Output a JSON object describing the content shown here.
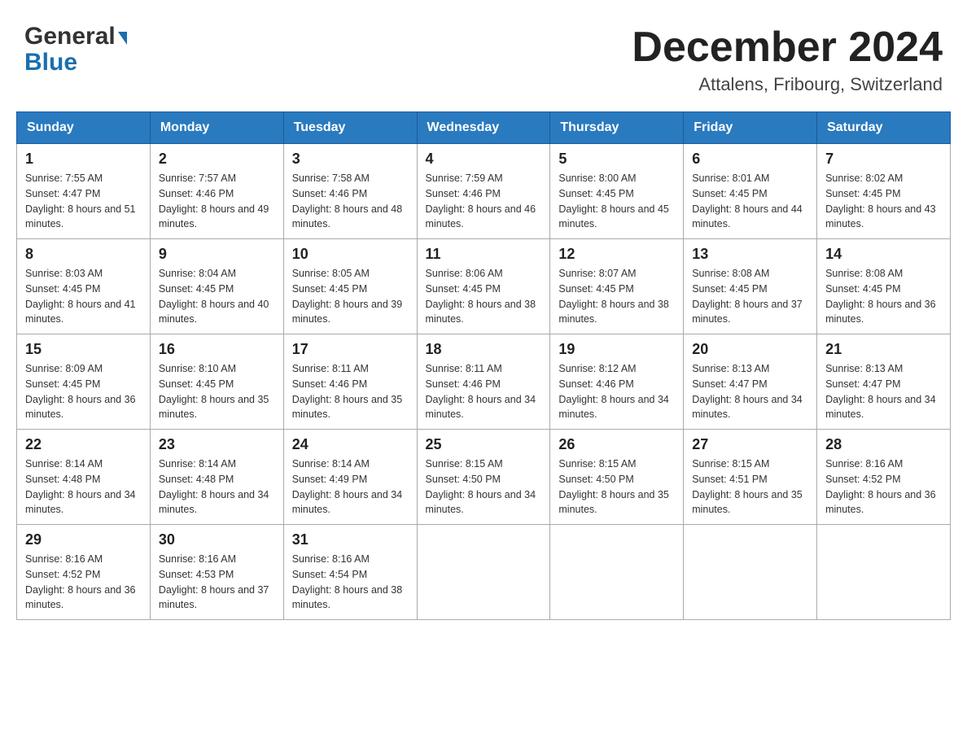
{
  "header": {
    "logo_general": "General",
    "logo_blue": "Blue",
    "main_title": "December 2024",
    "subtitle": "Attalens, Fribourg, Switzerland"
  },
  "weekdays": [
    "Sunday",
    "Monday",
    "Tuesday",
    "Wednesday",
    "Thursday",
    "Friday",
    "Saturday"
  ],
  "weeks": [
    [
      {
        "day": "1",
        "sunrise": "Sunrise: 7:55 AM",
        "sunset": "Sunset: 4:47 PM",
        "daylight": "Daylight: 8 hours and 51 minutes."
      },
      {
        "day": "2",
        "sunrise": "Sunrise: 7:57 AM",
        "sunset": "Sunset: 4:46 PM",
        "daylight": "Daylight: 8 hours and 49 minutes."
      },
      {
        "day": "3",
        "sunrise": "Sunrise: 7:58 AM",
        "sunset": "Sunset: 4:46 PM",
        "daylight": "Daylight: 8 hours and 48 minutes."
      },
      {
        "day": "4",
        "sunrise": "Sunrise: 7:59 AM",
        "sunset": "Sunset: 4:46 PM",
        "daylight": "Daylight: 8 hours and 46 minutes."
      },
      {
        "day": "5",
        "sunrise": "Sunrise: 8:00 AM",
        "sunset": "Sunset: 4:45 PM",
        "daylight": "Daylight: 8 hours and 45 minutes."
      },
      {
        "day": "6",
        "sunrise": "Sunrise: 8:01 AM",
        "sunset": "Sunset: 4:45 PM",
        "daylight": "Daylight: 8 hours and 44 minutes."
      },
      {
        "day": "7",
        "sunrise": "Sunrise: 8:02 AM",
        "sunset": "Sunset: 4:45 PM",
        "daylight": "Daylight: 8 hours and 43 minutes."
      }
    ],
    [
      {
        "day": "8",
        "sunrise": "Sunrise: 8:03 AM",
        "sunset": "Sunset: 4:45 PM",
        "daylight": "Daylight: 8 hours and 41 minutes."
      },
      {
        "day": "9",
        "sunrise": "Sunrise: 8:04 AM",
        "sunset": "Sunset: 4:45 PM",
        "daylight": "Daylight: 8 hours and 40 minutes."
      },
      {
        "day": "10",
        "sunrise": "Sunrise: 8:05 AM",
        "sunset": "Sunset: 4:45 PM",
        "daylight": "Daylight: 8 hours and 39 minutes."
      },
      {
        "day": "11",
        "sunrise": "Sunrise: 8:06 AM",
        "sunset": "Sunset: 4:45 PM",
        "daylight": "Daylight: 8 hours and 38 minutes."
      },
      {
        "day": "12",
        "sunrise": "Sunrise: 8:07 AM",
        "sunset": "Sunset: 4:45 PM",
        "daylight": "Daylight: 8 hours and 38 minutes."
      },
      {
        "day": "13",
        "sunrise": "Sunrise: 8:08 AM",
        "sunset": "Sunset: 4:45 PM",
        "daylight": "Daylight: 8 hours and 37 minutes."
      },
      {
        "day": "14",
        "sunrise": "Sunrise: 8:08 AM",
        "sunset": "Sunset: 4:45 PM",
        "daylight": "Daylight: 8 hours and 36 minutes."
      }
    ],
    [
      {
        "day": "15",
        "sunrise": "Sunrise: 8:09 AM",
        "sunset": "Sunset: 4:45 PM",
        "daylight": "Daylight: 8 hours and 36 minutes."
      },
      {
        "day": "16",
        "sunrise": "Sunrise: 8:10 AM",
        "sunset": "Sunset: 4:45 PM",
        "daylight": "Daylight: 8 hours and 35 minutes."
      },
      {
        "day": "17",
        "sunrise": "Sunrise: 8:11 AM",
        "sunset": "Sunset: 4:46 PM",
        "daylight": "Daylight: 8 hours and 35 minutes."
      },
      {
        "day": "18",
        "sunrise": "Sunrise: 8:11 AM",
        "sunset": "Sunset: 4:46 PM",
        "daylight": "Daylight: 8 hours and 34 minutes."
      },
      {
        "day": "19",
        "sunrise": "Sunrise: 8:12 AM",
        "sunset": "Sunset: 4:46 PM",
        "daylight": "Daylight: 8 hours and 34 minutes."
      },
      {
        "day": "20",
        "sunrise": "Sunrise: 8:13 AM",
        "sunset": "Sunset: 4:47 PM",
        "daylight": "Daylight: 8 hours and 34 minutes."
      },
      {
        "day": "21",
        "sunrise": "Sunrise: 8:13 AM",
        "sunset": "Sunset: 4:47 PM",
        "daylight": "Daylight: 8 hours and 34 minutes."
      }
    ],
    [
      {
        "day": "22",
        "sunrise": "Sunrise: 8:14 AM",
        "sunset": "Sunset: 4:48 PM",
        "daylight": "Daylight: 8 hours and 34 minutes."
      },
      {
        "day": "23",
        "sunrise": "Sunrise: 8:14 AM",
        "sunset": "Sunset: 4:48 PM",
        "daylight": "Daylight: 8 hours and 34 minutes."
      },
      {
        "day": "24",
        "sunrise": "Sunrise: 8:14 AM",
        "sunset": "Sunset: 4:49 PM",
        "daylight": "Daylight: 8 hours and 34 minutes."
      },
      {
        "day": "25",
        "sunrise": "Sunrise: 8:15 AM",
        "sunset": "Sunset: 4:50 PM",
        "daylight": "Daylight: 8 hours and 34 minutes."
      },
      {
        "day": "26",
        "sunrise": "Sunrise: 8:15 AM",
        "sunset": "Sunset: 4:50 PM",
        "daylight": "Daylight: 8 hours and 35 minutes."
      },
      {
        "day": "27",
        "sunrise": "Sunrise: 8:15 AM",
        "sunset": "Sunset: 4:51 PM",
        "daylight": "Daylight: 8 hours and 35 minutes."
      },
      {
        "day": "28",
        "sunrise": "Sunrise: 8:16 AM",
        "sunset": "Sunset: 4:52 PM",
        "daylight": "Daylight: 8 hours and 36 minutes."
      }
    ],
    [
      {
        "day": "29",
        "sunrise": "Sunrise: 8:16 AM",
        "sunset": "Sunset: 4:52 PM",
        "daylight": "Daylight: 8 hours and 36 minutes."
      },
      {
        "day": "30",
        "sunrise": "Sunrise: 8:16 AM",
        "sunset": "Sunset: 4:53 PM",
        "daylight": "Daylight: 8 hours and 37 minutes."
      },
      {
        "day": "31",
        "sunrise": "Sunrise: 8:16 AM",
        "sunset": "Sunset: 4:54 PM",
        "daylight": "Daylight: 8 hours and 38 minutes."
      },
      null,
      null,
      null,
      null
    ]
  ]
}
